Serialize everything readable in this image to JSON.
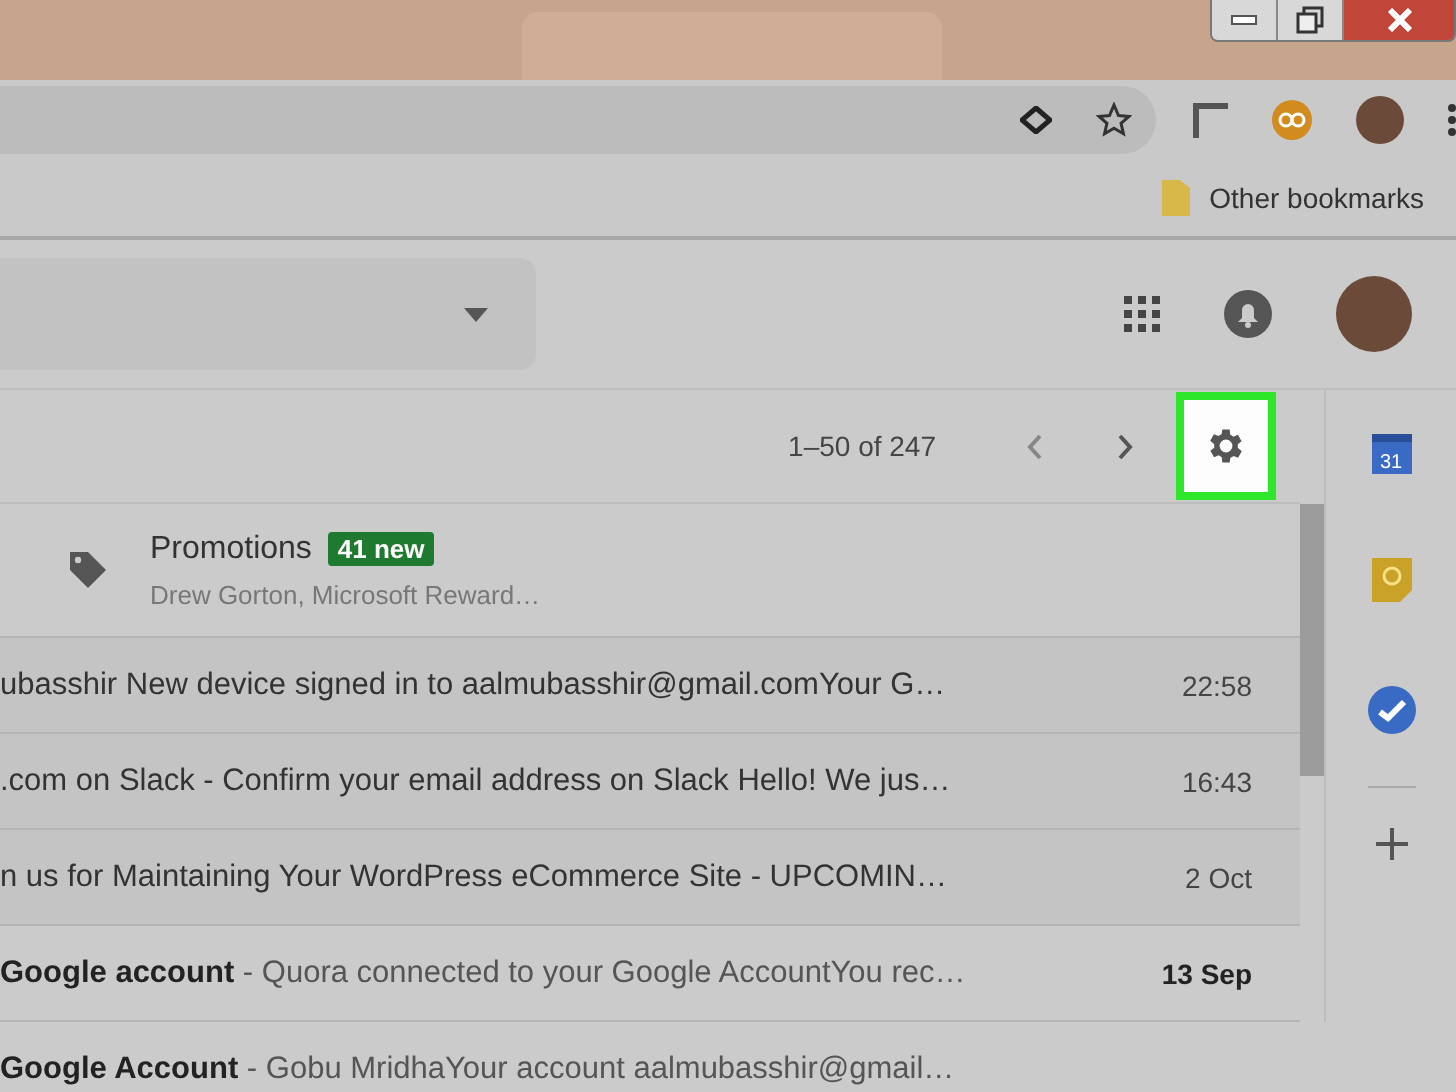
{
  "bookmarks_bar": {
    "items": [
      {
        "label": "Other bookmarks"
      }
    ]
  },
  "toolbar": {
    "page_range": "1–50 of 247"
  },
  "side_panel": {
    "calendar_day": "31"
  },
  "promotions": {
    "label": "Promotions",
    "badge": "41 new",
    "senders": "Drew Gorton, Microsoft Reward…"
  },
  "emails": [
    {
      "text": "ubasshir New device signed in to aalmubasshir@gmail.comYour G…",
      "date": "22:58",
      "unread": false
    },
    {
      "text": ".com on Slack - Confirm your email address on Slack Hello! We jus…",
      "date": "16:43",
      "unread": false
    },
    {
      "text": "n us for Maintaining Your WordPress eCommerce Site - UPCOMIN…",
      "date": "2 Oct",
      "unread": false
    },
    {
      "text": "**Google account** - Quora connected to your Google AccountYou rec…",
      "date": "13 Sep",
      "unread": true
    },
    {
      "text": "**Google Account** - Gobu MridhaYour account aalmubasshir@gmail…",
      "unread": true
    }
  ]
}
